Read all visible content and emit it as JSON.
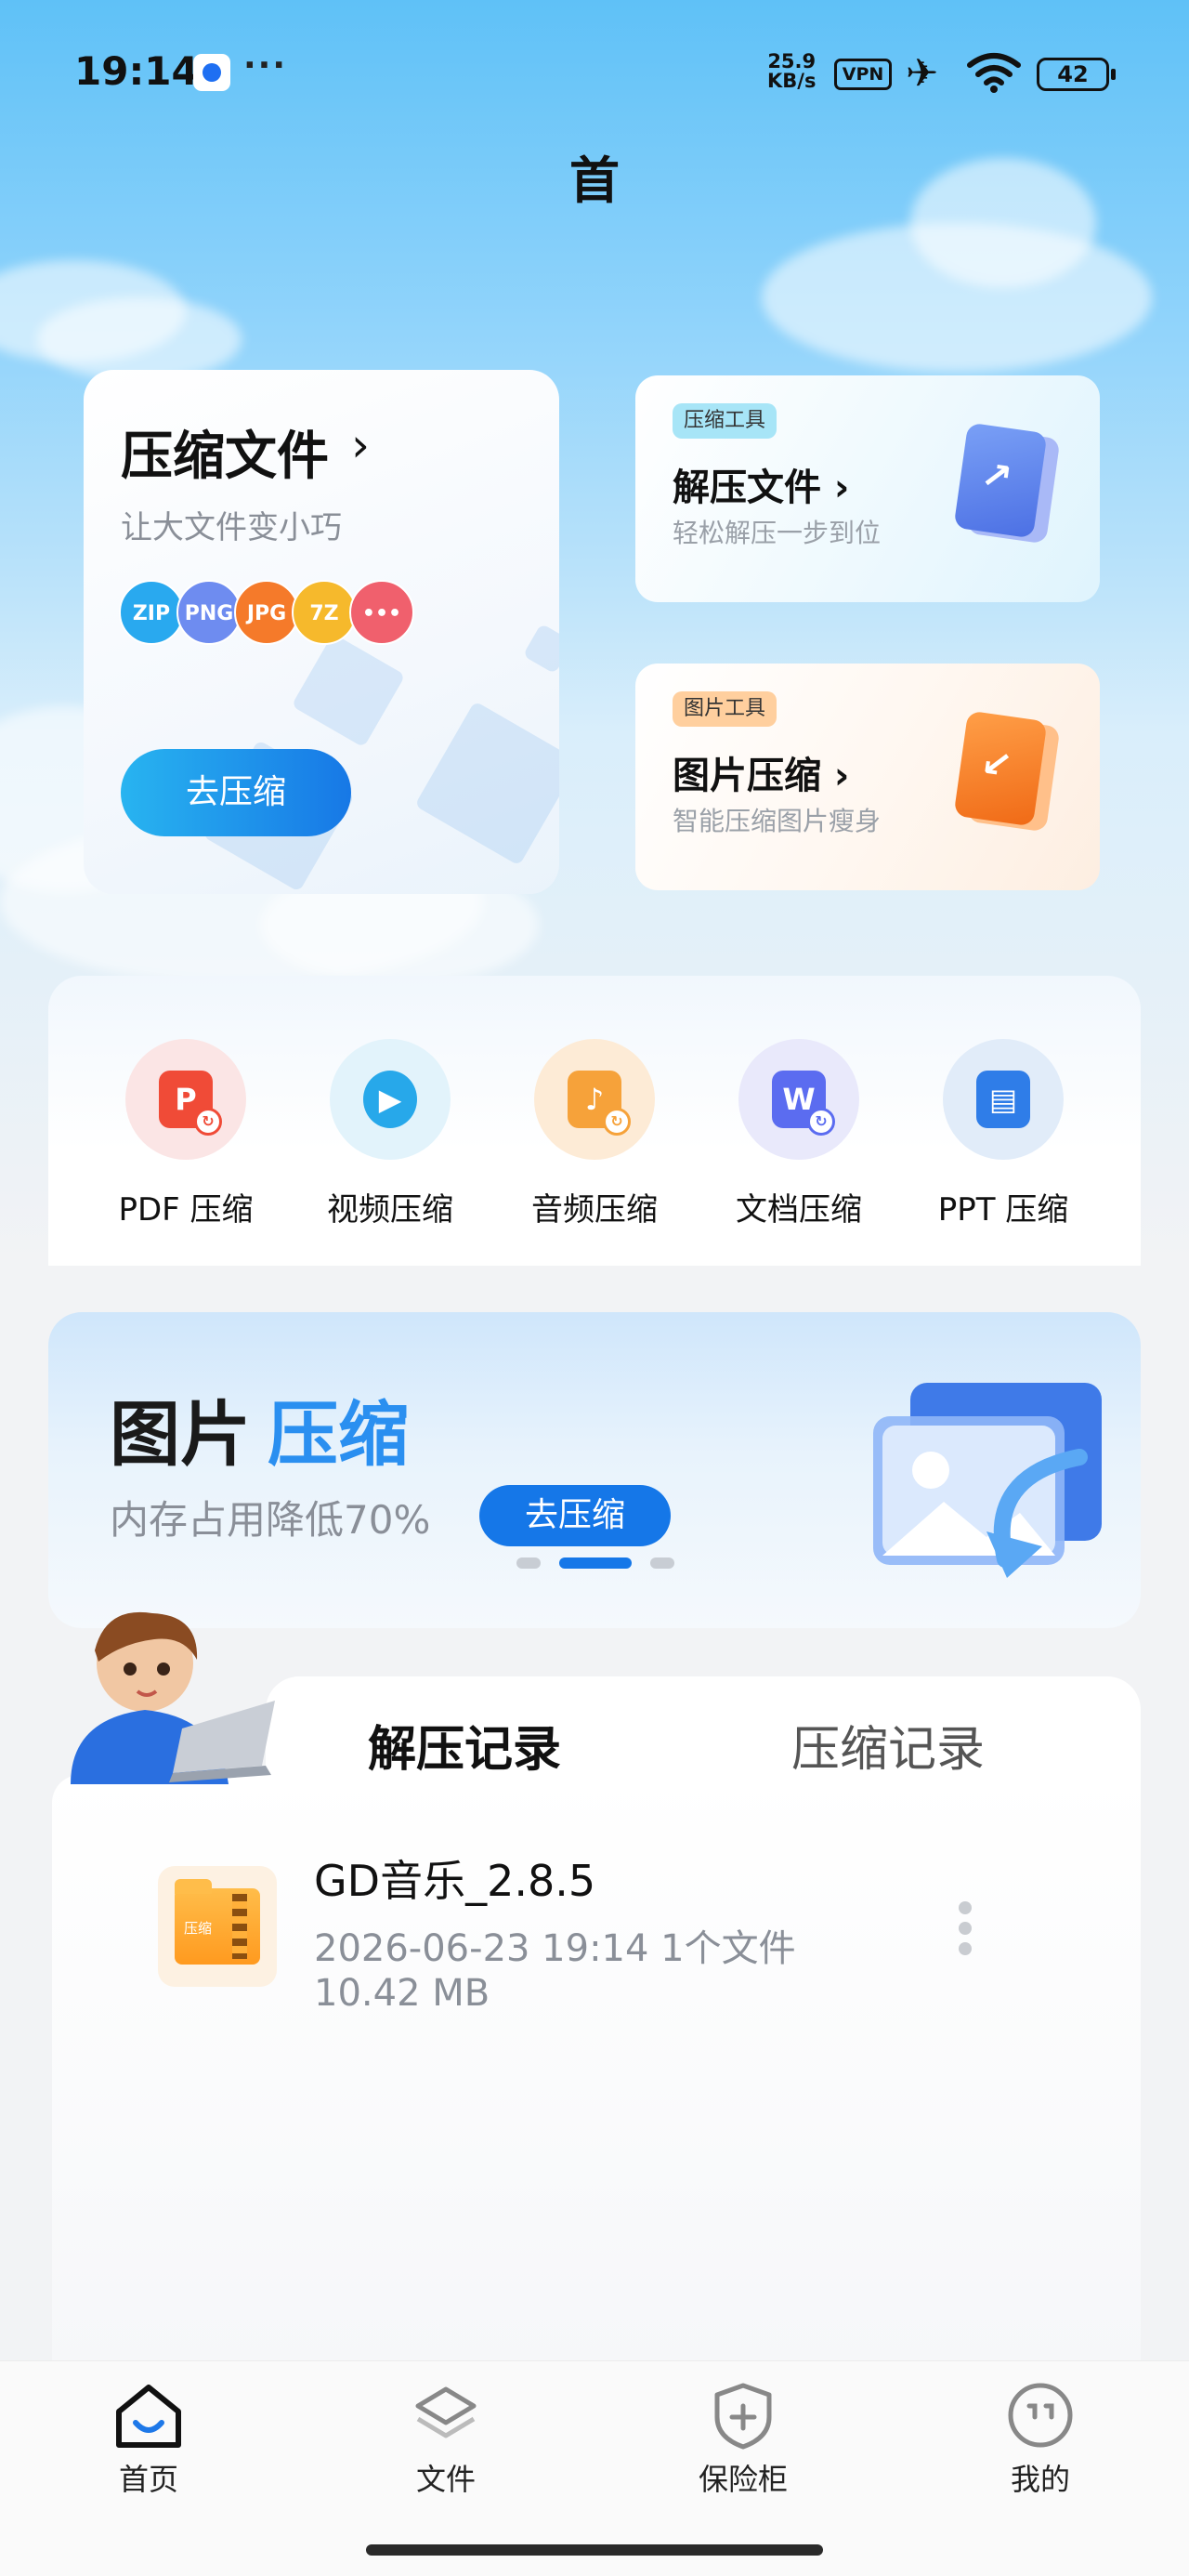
{
  "status_bar": {
    "time": "19:14",
    "net_speed_value": "25.9",
    "net_speed_unit": "KB/s",
    "vpn": "VPN",
    "battery": "42"
  },
  "header": {
    "title": "首"
  },
  "compress_card": {
    "title": "压缩文件",
    "subtitle": "让大文件变小巧",
    "formats": [
      {
        "label": "ZIP",
        "color": "#29a9ef"
      },
      {
        "label": "PNG",
        "color": "#6e8cf0"
      },
      {
        "label": "JPG",
        "color": "#f57a2a"
      },
      {
        "label": "7Z",
        "color": "#f6b92c"
      },
      {
        "label": "•••",
        "color": "#f0606d"
      }
    ],
    "button": "去压缩"
  },
  "tool_cards": [
    {
      "tag": "压缩工具",
      "title": "解压文件",
      "subtitle": "轻松解压一步到位",
      "tag_color": "#9ee3f6",
      "accent": "#5b86ec",
      "glyph": "↗"
    },
    {
      "tag": "图片工具",
      "title": "图片压缩",
      "subtitle": "智能压缩图片瘦身",
      "tag_color": "#ffc894",
      "accent": "#f57c22",
      "glyph": "↙"
    }
  ],
  "categories": [
    {
      "label": "PDF 压缩",
      "icon": "pdf-icon",
      "glyph": "P",
      "color": "#f04b37",
      "bg": "#fbe5e5"
    },
    {
      "label": "视频压缩",
      "icon": "video-icon",
      "glyph": "▶",
      "color": "#27a8ea",
      "bg": "#e2f3fb"
    },
    {
      "label": "音频压缩",
      "icon": "audio-icon",
      "glyph": "♪",
      "color": "#f6a23a",
      "bg": "#fdebd6"
    },
    {
      "label": "文档压缩",
      "icon": "document-icon",
      "glyph": "W",
      "color": "#5b6cf0",
      "bg": "#e9e9fb"
    },
    {
      "label": "PPT 压缩",
      "icon": "ppt-icon",
      "glyph": "▤",
      "color": "#2f7de8",
      "bg": "#e1ecf9"
    }
  ],
  "banner": {
    "title_part1": "图片",
    "title_part2": "压缩",
    "subtitle": "内存占用降低70%",
    "button": "去压缩"
  },
  "records": {
    "tabs": [
      "解压记录",
      "压缩记录"
    ],
    "active_tab": "解压记录",
    "items": [
      {
        "name": "GD音乐_2.8.5",
        "datetime": "2026-06-23 19:14",
        "count": "1个文件",
        "size": "10.42 MB",
        "folder_label": "压缩"
      }
    ]
  },
  "bottom_nav": [
    {
      "label": "首页",
      "icon": "home-icon"
    },
    {
      "label": "文件",
      "icon": "layers-icon"
    },
    {
      "label": "保险柜",
      "icon": "shield-icon"
    },
    {
      "label": "我的",
      "icon": "profile-icon"
    }
  ]
}
